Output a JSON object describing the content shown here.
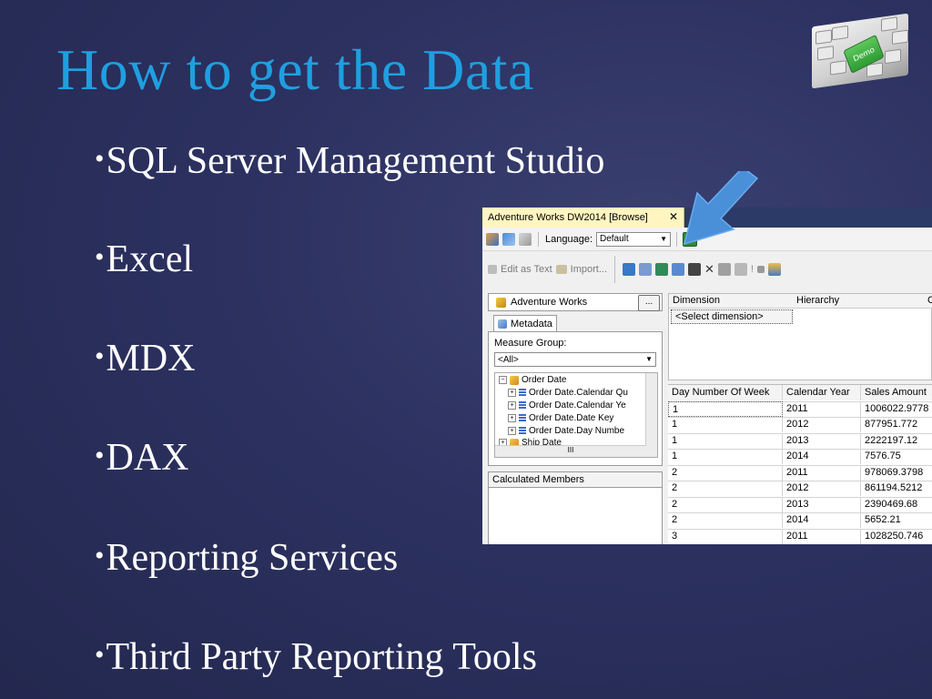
{
  "slide": {
    "title": "How to get the Data",
    "bullets": [
      "SQL Server Management Studio",
      "Excel",
      "MDX",
      "DAX",
      "Reporting Services",
      "Third Party Reporting Tools"
    ]
  },
  "demo_image": {
    "key_label": "Demo"
  },
  "screenshot": {
    "tab_title": "Adventure Works DW2014 [Browse]",
    "tab_close": "✕",
    "language_label": "Language:",
    "language_value": "Default",
    "edit_as_text": "Edit as Text",
    "import": "Import...",
    "cube_name": "Adventure Works",
    "ellipsis": "...",
    "metadata_tab": "Metadata",
    "measure_group_label": "Measure Group:",
    "measure_group_value": "<All>",
    "tree_items": [
      "Order Date",
      "Order Date.Calendar Qu",
      "Order Date.Calendar Ye",
      "Order Date.Date Key",
      "Order Date.Day Numbe",
      "Ship Date"
    ],
    "hscroll_thumb": "III",
    "calculated_members": "Calculated Members",
    "filter_headers": [
      "Dimension",
      "Hierarchy",
      "C"
    ],
    "select_dimension": "<Select dimension>",
    "grid_headers": [
      "Day Number Of Week",
      "Calendar Year",
      "Sales Amount"
    ],
    "grid_rows": [
      [
        "1",
        "2011",
        "1006022.9778"
      ],
      [
        "1",
        "2012",
        "877951.772"
      ],
      [
        "1",
        "2013",
        "2222197.12"
      ],
      [
        "1",
        "2014",
        "7576.75"
      ],
      [
        "2",
        "2011",
        "978069.3798"
      ],
      [
        "2",
        "2012",
        "861194.5212"
      ],
      [
        "2",
        "2013",
        "2390469.68"
      ],
      [
        "2",
        "2014",
        "5652.21"
      ],
      [
        "3",
        "2011",
        "1028250.746"
      ]
    ]
  },
  "colors": {
    "title": "#1f9fe0",
    "background": "#2c3160",
    "arrow": "#4a90d9",
    "tab_active": "#fff5c0"
  }
}
